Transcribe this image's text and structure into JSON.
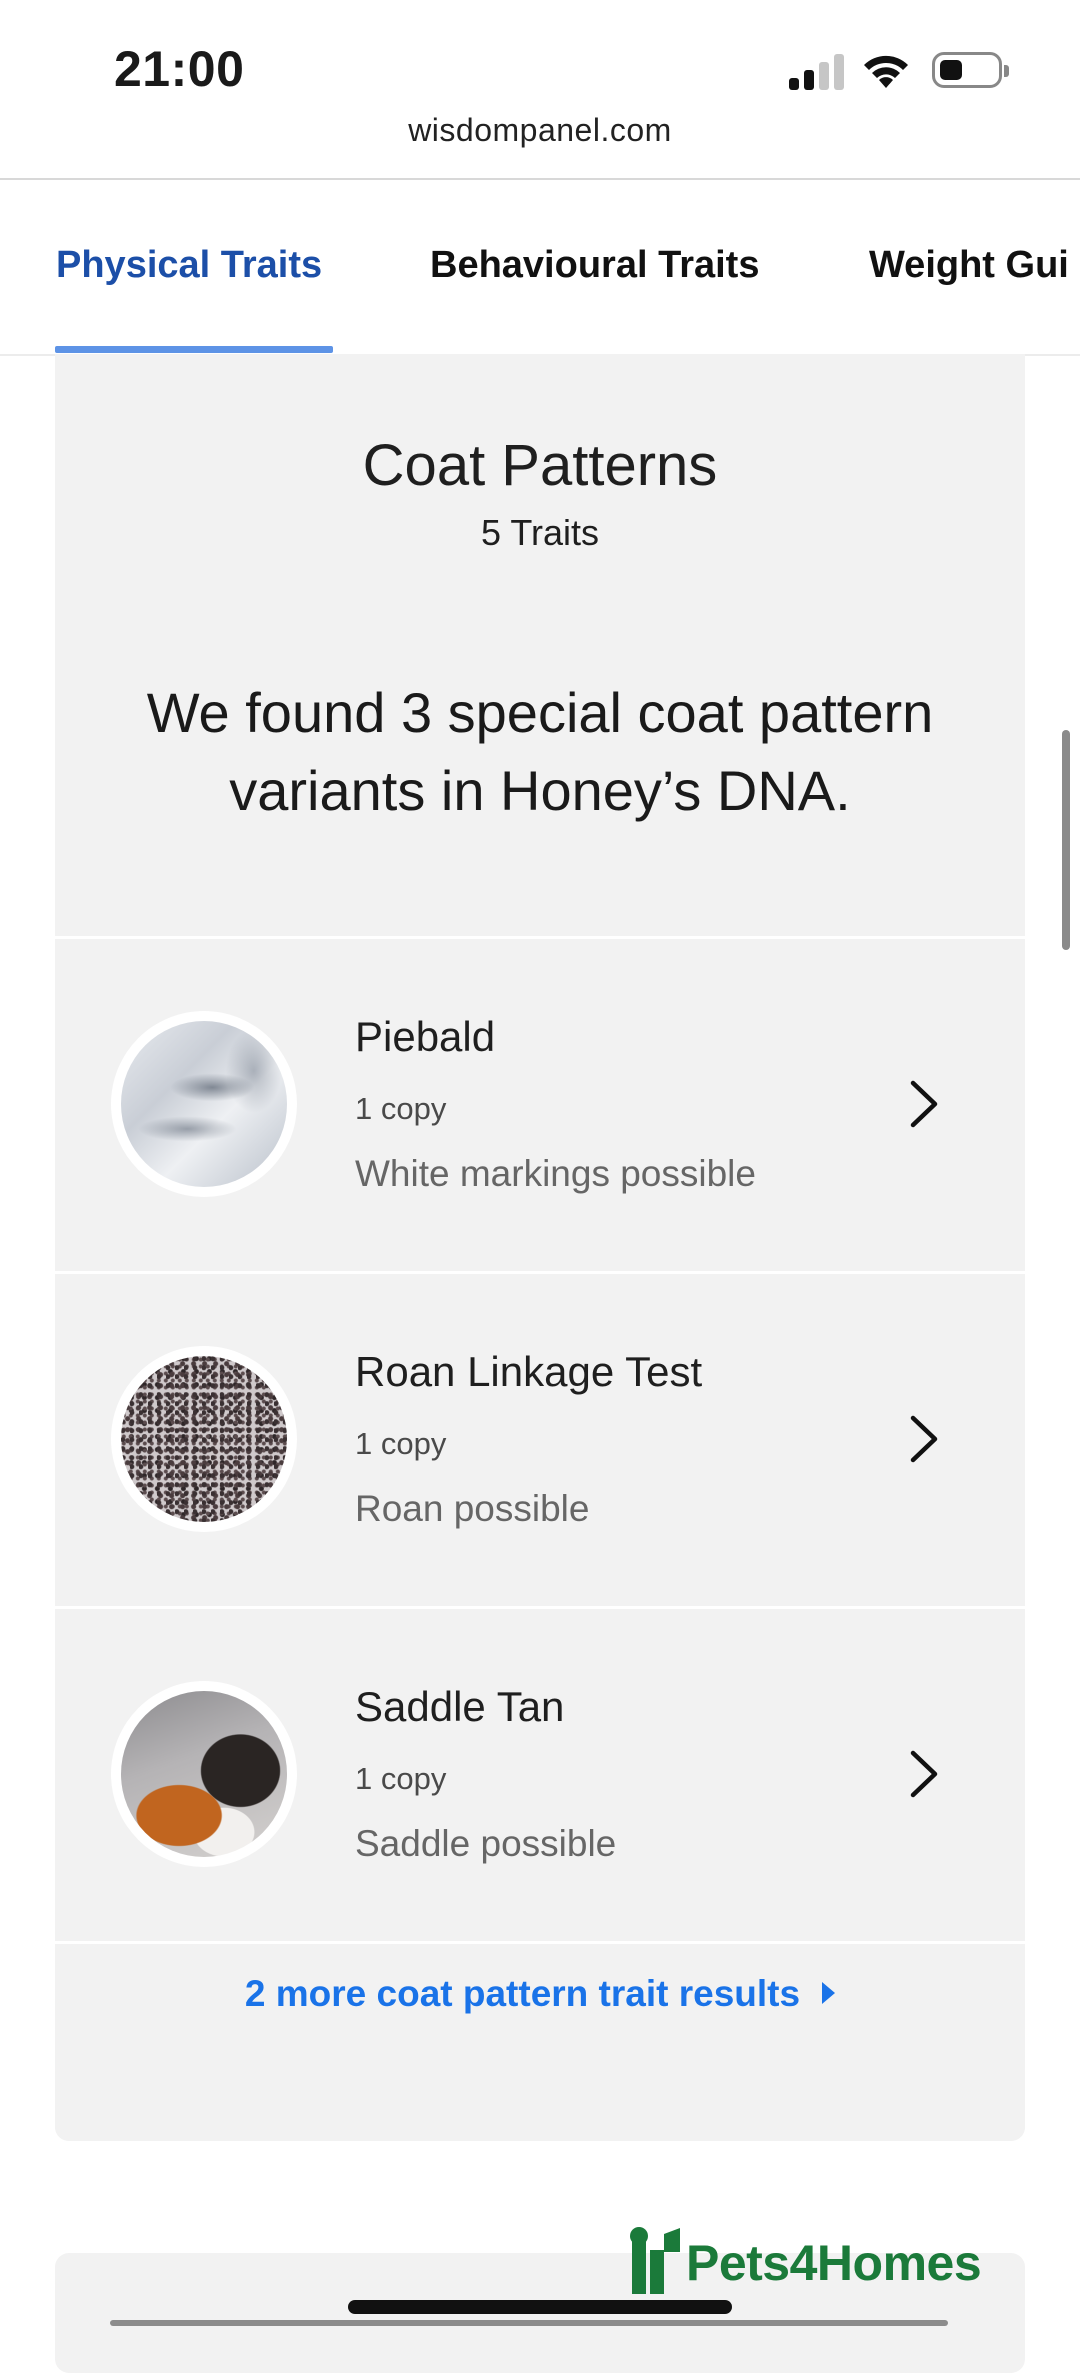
{
  "status_bar": {
    "time": "21:00",
    "url": "wisdompanel.com",
    "icons": [
      "cellular-signal-icon",
      "wifi-icon",
      "battery-icon"
    ]
  },
  "tabs": [
    {
      "label": "Physical Traits",
      "active": true
    },
    {
      "label": "Behavioural Traits",
      "active": false
    },
    {
      "label": "Weight Gui",
      "active": false
    }
  ],
  "card": {
    "title": "Coat Patterns",
    "subtitle": "5 Traits",
    "headline": "We found 3 special coat pattern variants in Honey’s DNA.",
    "traits": [
      {
        "name": "Piebald",
        "copies": "1 copy",
        "description": "White markings possible",
        "image": "piebald-fur-image"
      },
      {
        "name": "Roan Linkage Test",
        "copies": "1 copy",
        "description": "Roan possible",
        "image": "roan-fur-image"
      },
      {
        "name": "Saddle Tan",
        "copies": "1 copy",
        "description": "Saddle possible",
        "image": "saddle-tan-dog-image"
      }
    ],
    "more_link": "2 more coat pattern trait results"
  },
  "watermark": {
    "text": "Pets4Homes"
  },
  "colors": {
    "active_tab": "#1c4fa8",
    "tab_underline": "#5d93e6",
    "link": "#1a73e8",
    "card_bg": "#f2f2f2",
    "watermark": "#1b7a3a"
  }
}
